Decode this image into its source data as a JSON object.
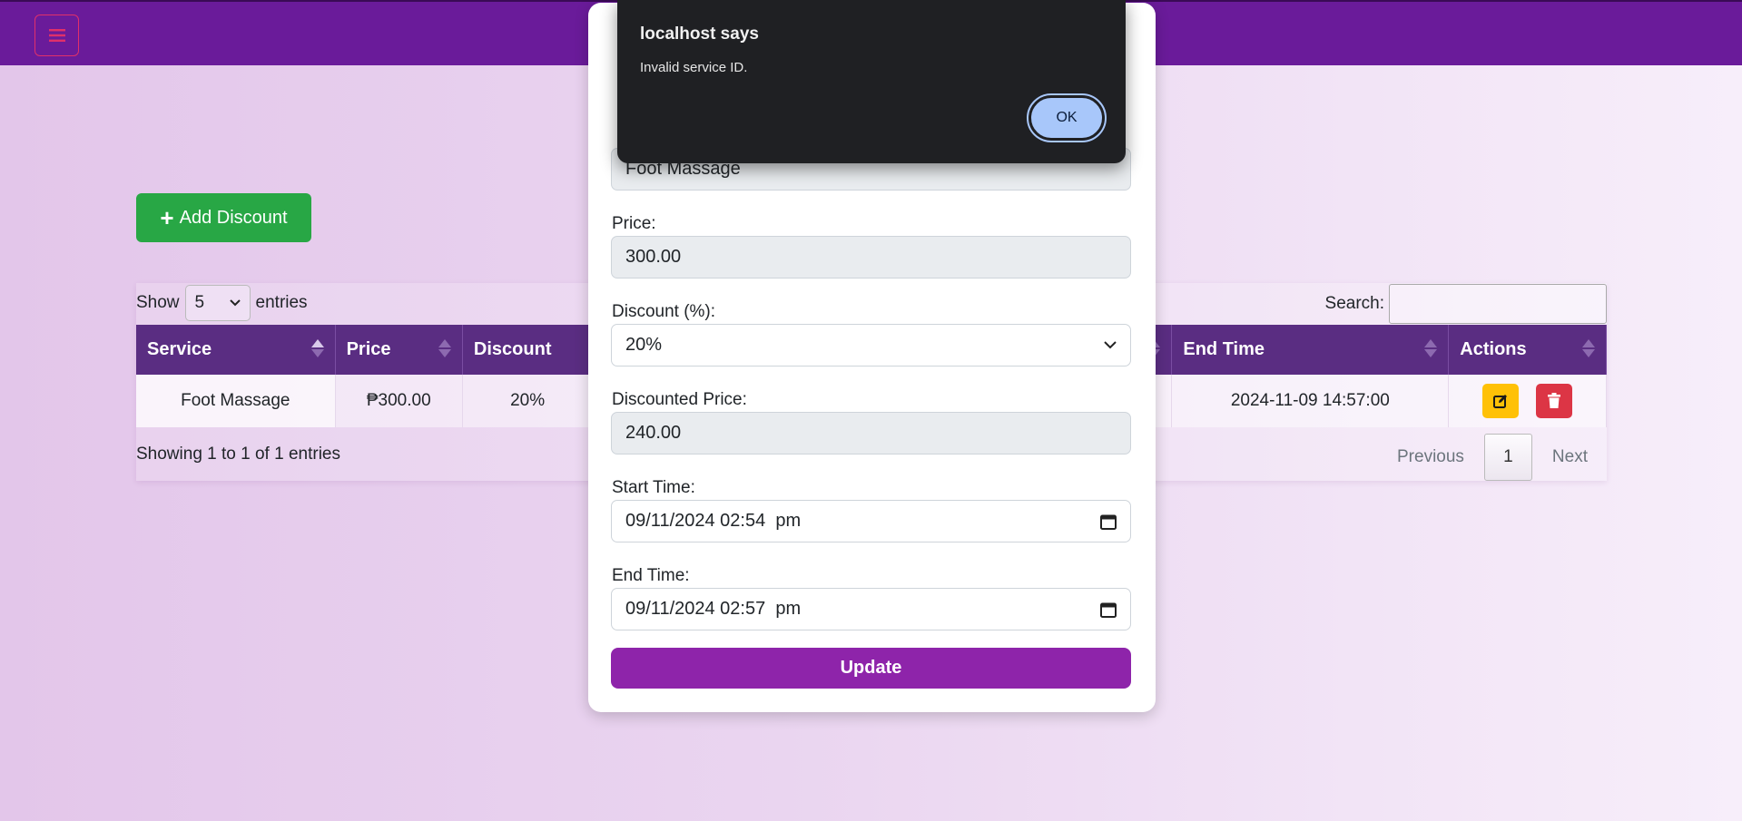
{
  "navbar": {
    "menu_icon": "hamburger-icon"
  },
  "toolbar": {
    "add_label": "Add Discount",
    "add_icon": "plus-icon"
  },
  "table_controls": {
    "show_label": "Show",
    "entries_value": "5",
    "entries_label": "entries",
    "search_label": "Search:",
    "search_value": ""
  },
  "table": {
    "headers": [
      "Service",
      "Price",
      "Discount",
      "End Time",
      "Actions"
    ],
    "rows": [
      {
        "service": "Foot Massage",
        "price": "₱300.00",
        "discount": "20%",
        "end_time": "2024-11-09 14:57:00"
      }
    ]
  },
  "footer": {
    "info": "Showing 1 to 1 of 1 entries",
    "previous": "Previous",
    "current_page": "1",
    "next": "Next"
  },
  "modal": {
    "service_value": "Foot Massage",
    "price_label": "Price:",
    "price_value": "300.00",
    "discount_label": "Discount (%):",
    "discount_value": "20%",
    "discounted_label": "Discounted Price:",
    "discounted_value": "240.00",
    "start_label": "Start Time:",
    "start_value": "09/11/2024 02:54  pm",
    "end_label": "End Time:",
    "end_value": "09/11/2024 02:57  pm",
    "update_label": "Update"
  },
  "alert": {
    "title": "localhost says",
    "message": "Invalid service ID.",
    "ok_label": "OK"
  },
  "colors": {
    "navbar": "#6a1b9a",
    "table_header": "#5a2d82",
    "add_button": "#28a745",
    "edit_button": "#ffc107",
    "delete_button": "#dc3545",
    "update_button": "#8e24aa",
    "alert_bg": "#1f2023",
    "alert_ok": "#a8c7fa"
  }
}
